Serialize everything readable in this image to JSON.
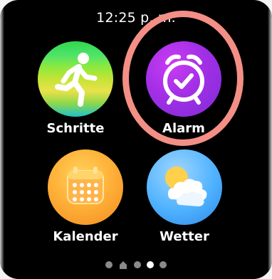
{
  "status": {
    "time": "12:25 p. m."
  },
  "apps": [
    {
      "label": "Schritte",
      "icon": "running-person-icon"
    },
    {
      "label": "Alarm",
      "icon": "alarm-clock-check-icon"
    },
    {
      "label": "Kalender",
      "icon": "calendar-icon"
    },
    {
      "label": "Wetter",
      "icon": "weather-sun-cloud-icon"
    }
  ],
  "pager": {
    "pages": 5,
    "home_index": 1,
    "active_index": 2
  },
  "colors": {
    "highlight_ring": "#f48f86",
    "background": "#000000",
    "label": "#ffffff"
  }
}
